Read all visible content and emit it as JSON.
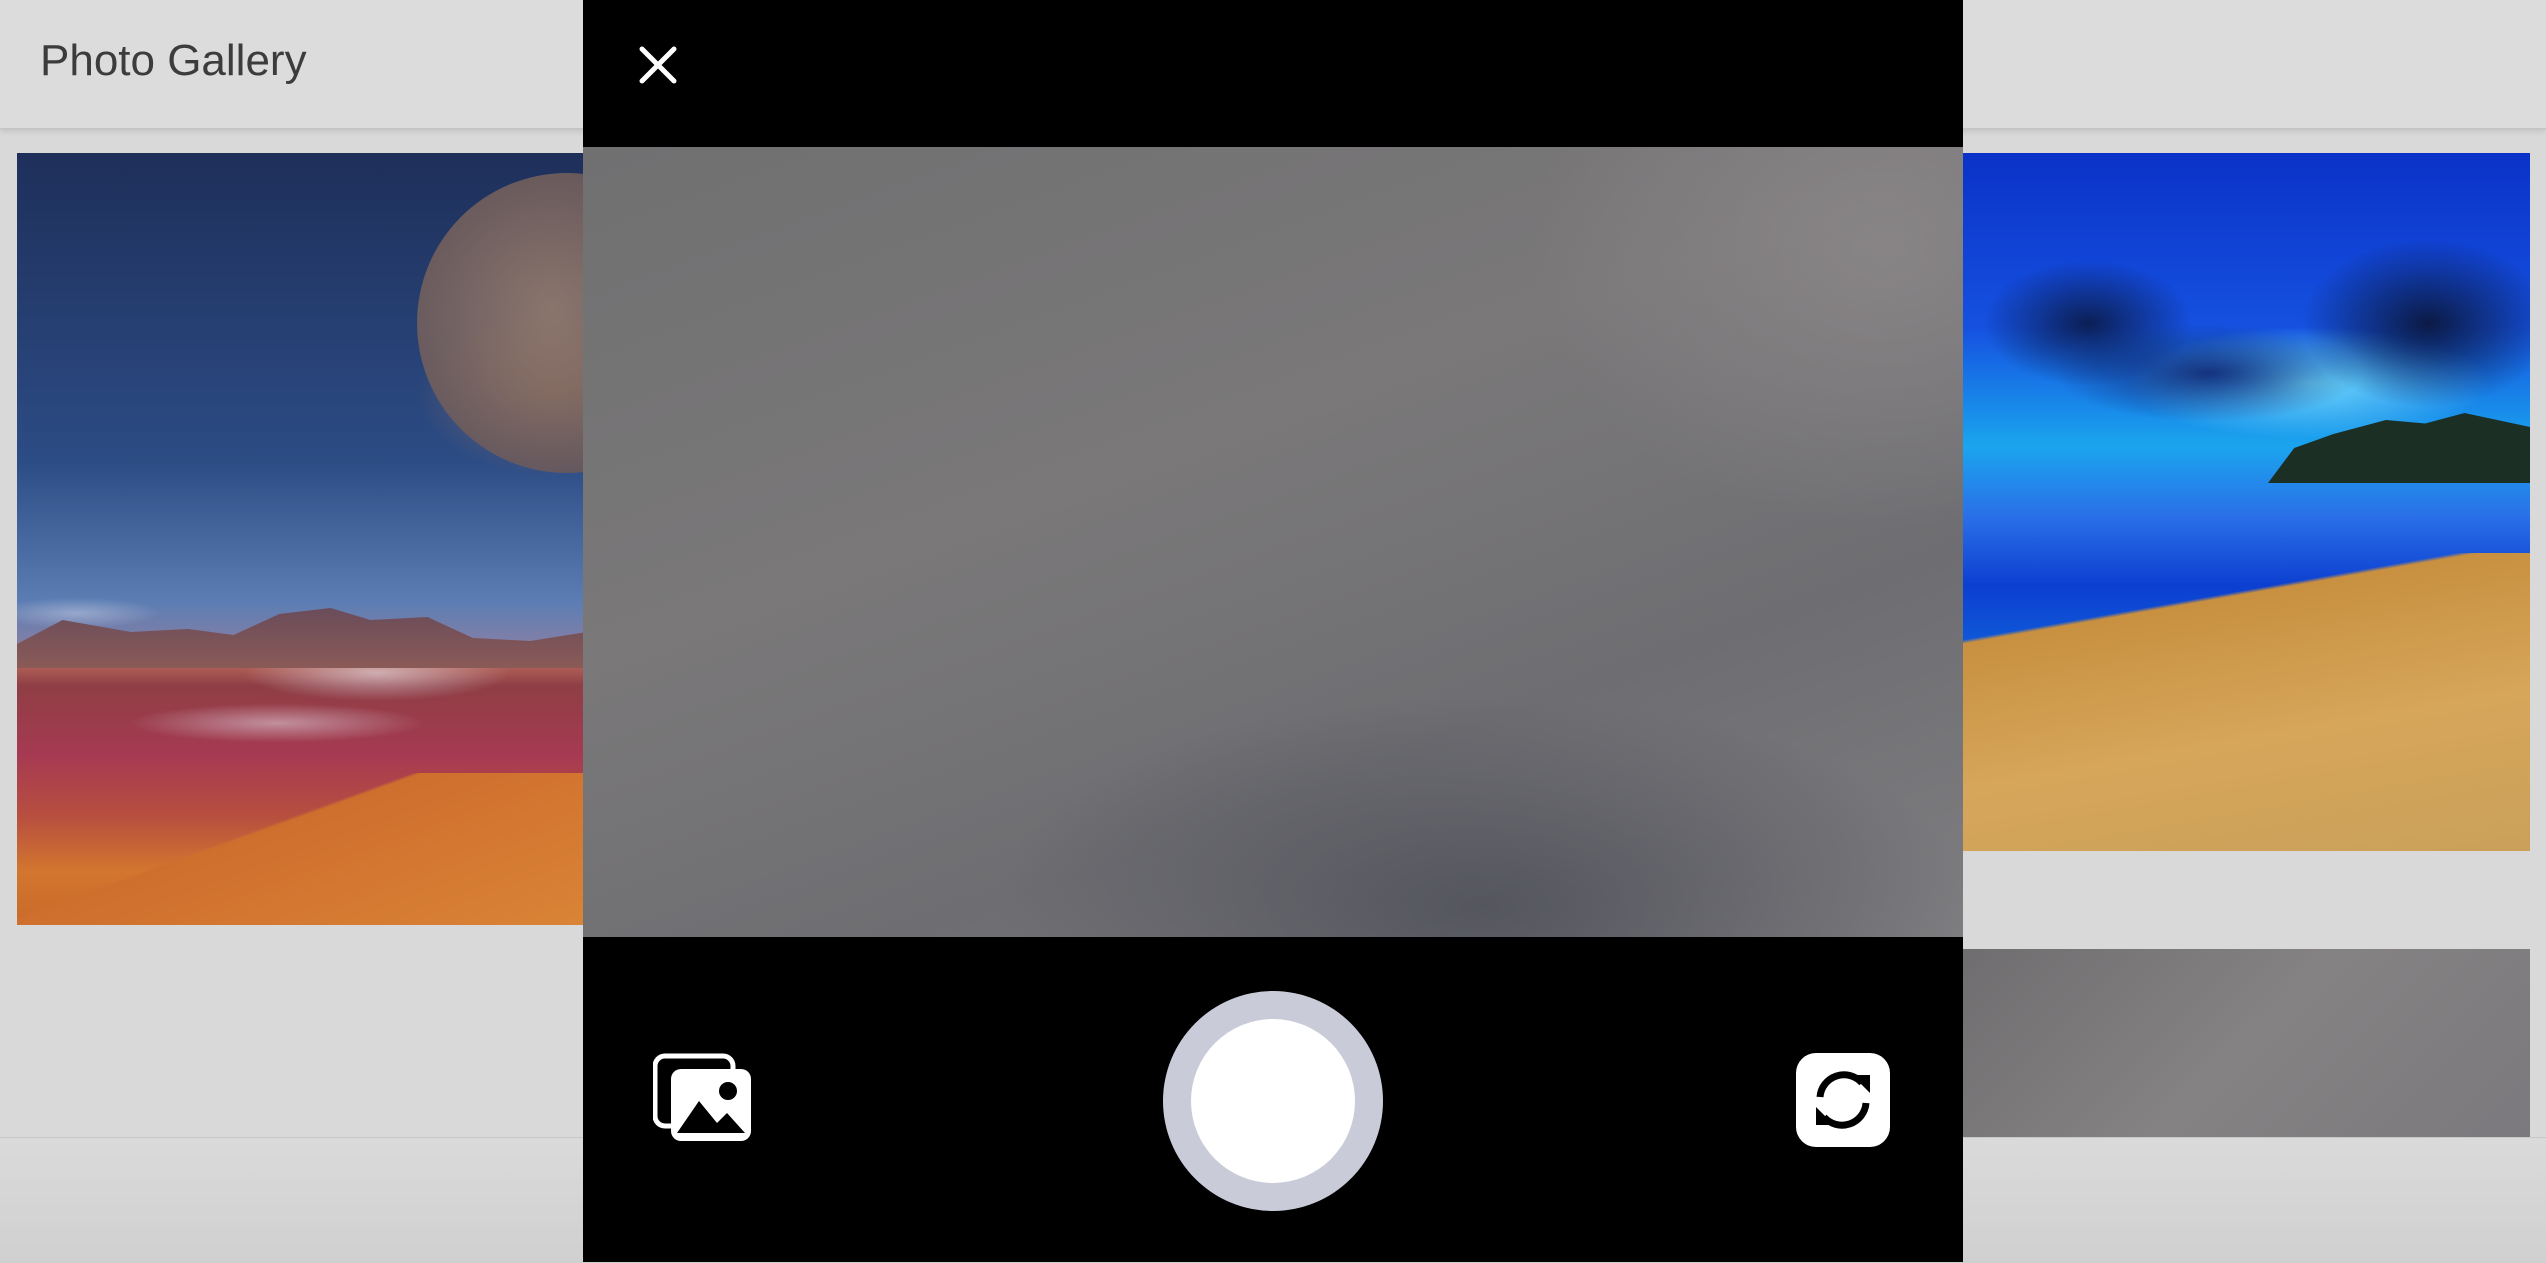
{
  "header": {
    "title": "Photo Gallery"
  },
  "gallery": {
    "photos": [
      {
        "name": "desert-lake-photo"
      },
      {
        "name": "night-beach-photo"
      },
      {
        "name": "grey-photo"
      }
    ]
  },
  "camera": {
    "close_icon": "close-icon",
    "gallery_icon": "photo-library-icon",
    "shutter_icon": "shutter-button",
    "flip_icon": "camera-flip-icon",
    "colors": {
      "background": "#000000",
      "shutter_ring": "#c9ccd8",
      "shutter_fill": "#ffffff"
    }
  }
}
